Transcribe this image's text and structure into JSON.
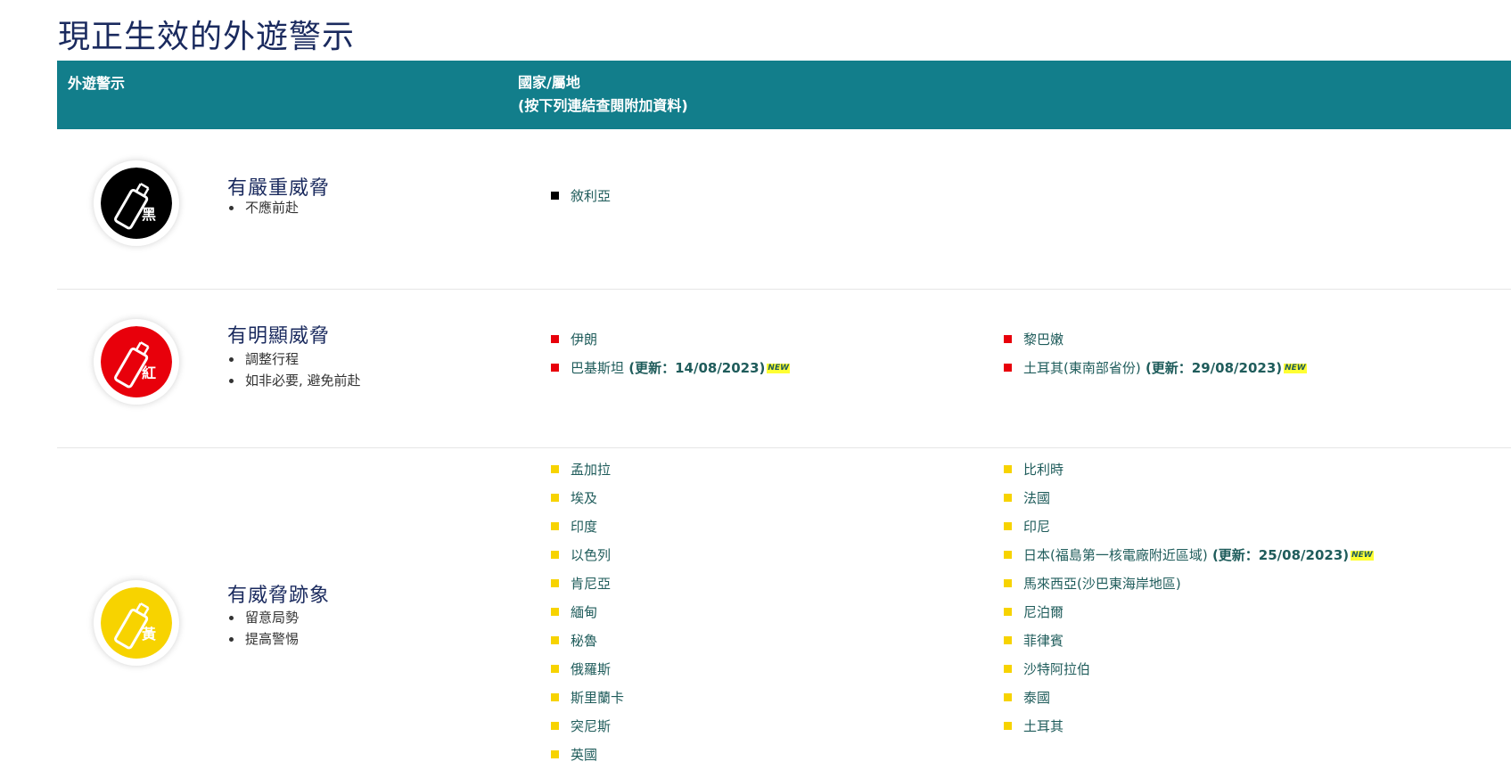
{
  "page_title": "現正生效的外遊警示",
  "table_header": {
    "alert_col": "外遊警示",
    "country_col_line1": "國家/屬地",
    "country_col_line2": "(按下列連結查閱附加資料)"
  },
  "levels": [
    {
      "badge_char": "黑",
      "badge_color": "#000000",
      "title": "有嚴重威脅",
      "advice": [
        "不應前赴"
      ],
      "col1": [
        {
          "name": "敘利亞"
        }
      ],
      "col2": []
    },
    {
      "badge_char": "紅",
      "badge_color": "#e8000b",
      "title": "有明顯威脅",
      "advice": [
        "調整行程",
        "如非必要, 避免前赴"
      ],
      "col1": [
        {
          "name": "伊朗"
        },
        {
          "name": "巴基斯坦",
          "update": " (更新：14/08/2023)",
          "new": "NEW"
        }
      ],
      "col2": [
        {
          "name": "黎巴嫩"
        },
        {
          "name": "土耳其(東南部省份)",
          "update": " (更新：29/08/2023)",
          "new": "NEW"
        }
      ]
    },
    {
      "badge_char": "黃",
      "badge_color": "#f7d300",
      "title": "有威脅跡象",
      "advice": [
        "留意局勢",
        "提高警惕"
      ],
      "col1": [
        {
          "name": "孟加拉"
        },
        {
          "name": "埃及"
        },
        {
          "name": "印度"
        },
        {
          "name": "以色列"
        },
        {
          "name": "肯尼亞"
        },
        {
          "name": "緬甸"
        },
        {
          "name": "秘魯"
        },
        {
          "name": "俄羅斯"
        },
        {
          "name": "斯里蘭卡"
        },
        {
          "name": "突尼斯"
        },
        {
          "name": "英國"
        }
      ],
      "col2": [
        {
          "name": "比利時"
        },
        {
          "name": "法國"
        },
        {
          "name": "印尼"
        },
        {
          "name": "日本(福島第一核電廠附近區域)",
          "update": " (更新：25/08/2023)",
          "new": "NEW"
        },
        {
          "name": "馬來西亞(沙巴東海岸地區)"
        },
        {
          "name": "尼泊爾"
        },
        {
          "name": "菲律賓"
        },
        {
          "name": "沙特阿拉伯"
        },
        {
          "name": "泰國"
        },
        {
          "name": "土耳其"
        }
      ]
    }
  ]
}
